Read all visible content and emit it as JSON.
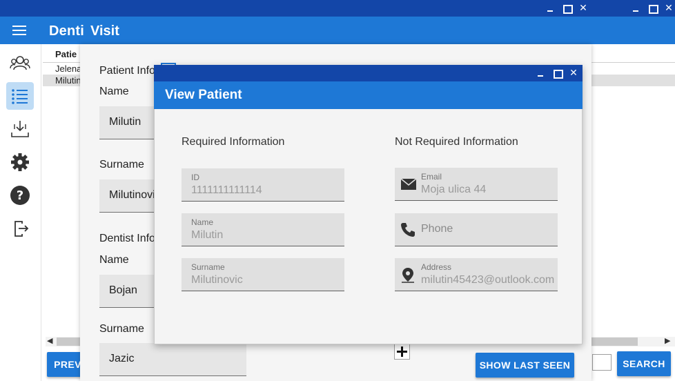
{
  "main_window": {
    "title": "Denti",
    "controls": {
      "minimize": "minimize",
      "maximize": "maximize",
      "close": "close"
    }
  },
  "sidebar": {
    "items": [
      {
        "icon": "users-icon",
        "active": false
      },
      {
        "icon": "list-icon",
        "active": true
      },
      {
        "icon": "download-icon",
        "active": false
      },
      {
        "icon": "gear-icon",
        "active": false
      },
      {
        "icon": "help-icon",
        "active": false
      },
      {
        "icon": "logout-icon",
        "active": false
      }
    ]
  },
  "patients_table": {
    "header": "Patie",
    "rows": [
      "Jelena",
      "Milutin"
    ]
  },
  "main_buttons": {
    "previous": "PREV",
    "search": "SEARCH"
  },
  "visit_window": {
    "title": "Visit",
    "patient_section": "Patient Info",
    "name_label": "Name",
    "name_value": "Milutin",
    "surname_label": "Surname",
    "surname_value": "Milutinovic",
    "dentist_section": "Dentist Info",
    "dentist_name_label": "Name",
    "dentist_name_value": "Bojan",
    "dentist_surname_label": "Surname",
    "dentist_surname_value": "Jazic",
    "show_last_seen": "SHOW LAST SEEN"
  },
  "dialog": {
    "title": "View Patient",
    "required_title": "Required Information",
    "not_required_title": "Not Required Information",
    "fields": {
      "id": {
        "label": "ID",
        "value": "1111111111114"
      },
      "name": {
        "label": "Name",
        "value": "Milutin"
      },
      "surname": {
        "label": "Surname",
        "value": "Milutinovic"
      },
      "email": {
        "label": "Email",
        "value": "Moja ulica 44"
      },
      "phone": {
        "placeholder": "Phone"
      },
      "address": {
        "label": "Address",
        "value": "milutin45423@outlook.com"
      }
    }
  },
  "colors": {
    "titlebar": "#1346a8",
    "appbar": "#1e78d6",
    "active_nav": "#bfdcf5"
  }
}
